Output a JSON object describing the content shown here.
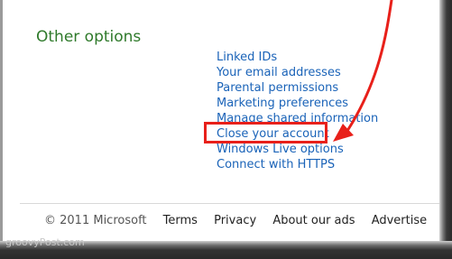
{
  "section": {
    "title": "Other options"
  },
  "options": [
    "Linked IDs",
    "Your email addresses",
    "Parental permissions",
    "Marketing preferences",
    "Manage shared information",
    "Close your account",
    "Windows Live options",
    "Connect with HTTPS"
  ],
  "footer": {
    "copyright": "© 2011 Microsoft",
    "terms": "Terms",
    "privacy": "Privacy",
    "about_ads": "About our ads",
    "advertise": "Advertise"
  },
  "annotation": {
    "highlight_color": "#e8201a",
    "highlighted_option": "Close your account"
  },
  "watermark": "groovyPost.com",
  "colors": {
    "title_green": "#2f7a2b",
    "link_blue": "#1a63b8"
  }
}
